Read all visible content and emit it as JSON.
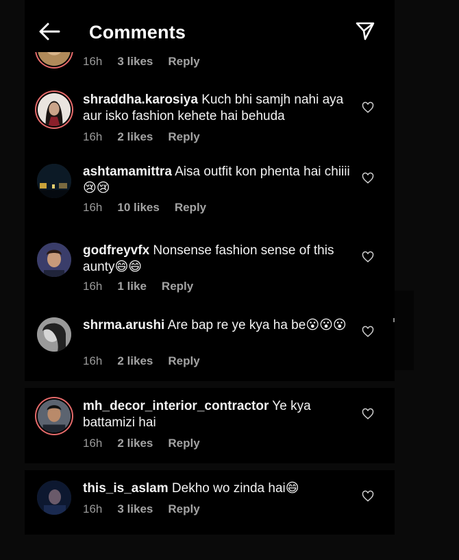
{
  "header": {
    "title": "Comments",
    "back_icon": "arrow-left-icon",
    "send_icon": "send-icon"
  },
  "top_partial": {
    "time": "16h",
    "likes": "3 likes",
    "reply": "Reply"
  },
  "comments": [
    {
      "username": "shraddha.karosiya",
      "text": "Kuch bhi samjh nahi aya aur isko fashion kehete hai behuda",
      "emojis": "",
      "time": "16h",
      "likes": "2 likes",
      "reply": "Reply"
    },
    {
      "username": "ashtamamittra",
      "text": "Aisa outfit kon phenta hai chiiii",
      "emojis": "😢😢",
      "time": "16h",
      "likes": "10 likes",
      "reply": "Reply"
    },
    {
      "username": "godfreyvfx",
      "text": "Nonsense fashion sense of this aunty",
      "emojis": "😄😄",
      "time": "16h",
      "likes": "1 like",
      "reply": "Reply"
    },
    {
      "username": "shrma.arushi",
      "text": "Are bap re ye kya ha be",
      "emojis": "😮😮😮",
      "time": "16h",
      "likes": "2 likes",
      "reply": "Reply"
    },
    {
      "username": "mh_decor_interior_contractor",
      "text": "Ye kya battamizi hai",
      "emojis": "",
      "time": "16h",
      "likes": "2 likes",
      "reply": "Reply"
    },
    {
      "username": "this_is_aslam",
      "text": "Dekho wo zinda hai",
      "emojis": "😄",
      "time": "16h",
      "likes": "3 likes",
      "reply": "Reply"
    }
  ],
  "colors": {
    "background": "#000000",
    "text": "#f2f2f2",
    "meta": "#9a9a9a",
    "story_ring": "#e56a6a"
  }
}
